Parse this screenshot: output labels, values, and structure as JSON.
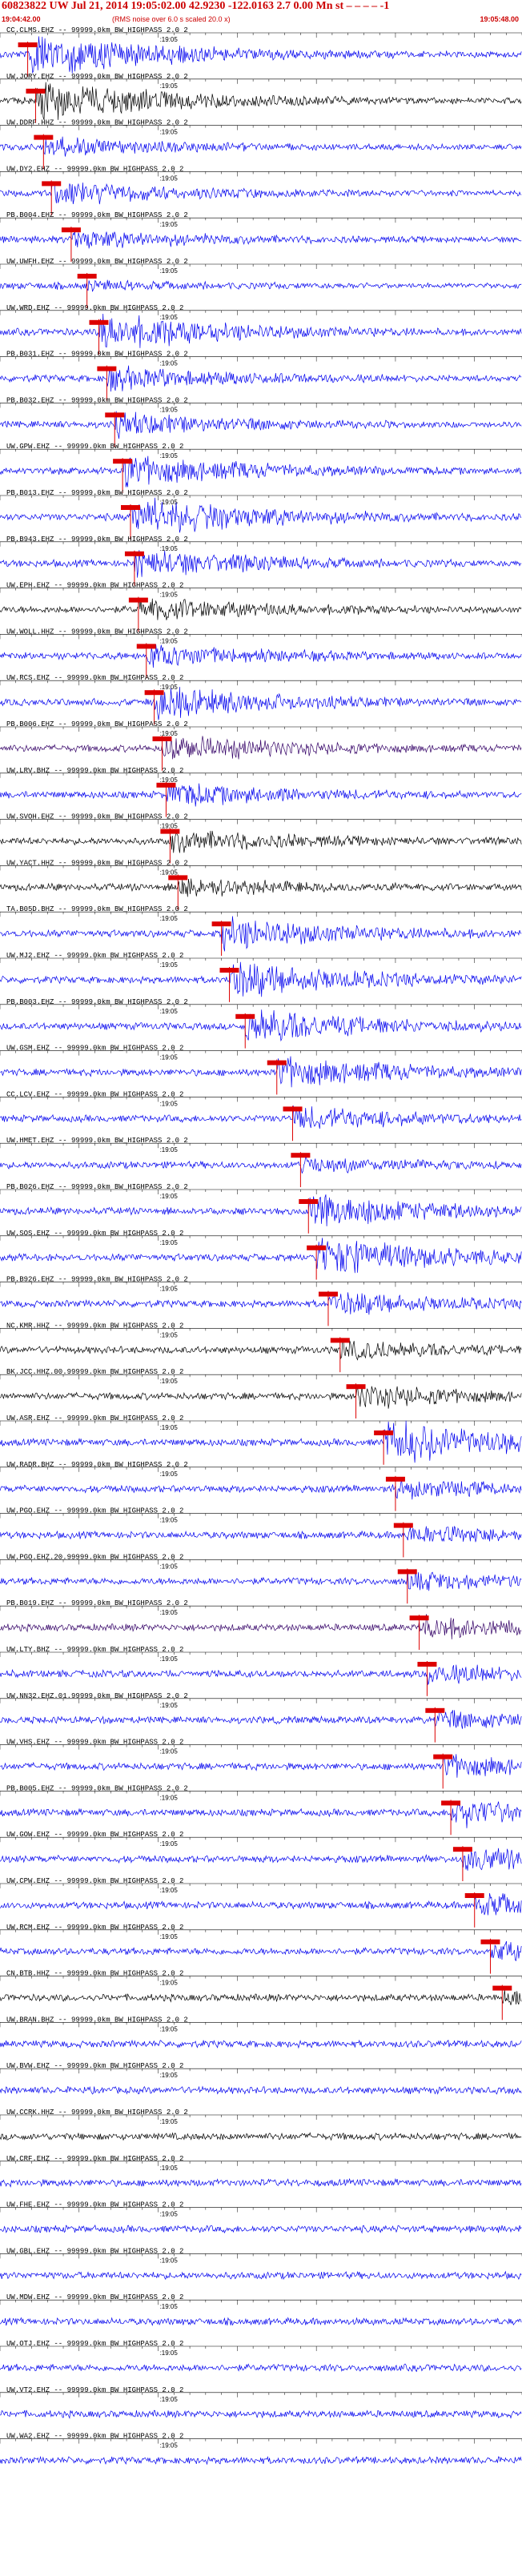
{
  "header": {
    "title": "60823822 UW Jul 21, 2014 19:05:02.00   42.9230  -122.0163   2.7  0.00  Mn st  – – – –  -1",
    "start_time": "19:04:42.00",
    "rms_note": "(RMS noise over 6.0 s scaled 20.0 x)",
    "end_time": "19:05:48.00"
  },
  "colors": {
    "header_red": "#cc0000",
    "pick_red": "#dd0000",
    "blue": "#0000ee",
    "black": "#000000",
    "purple": "#330066"
  },
  "chart_data": {
    "type": "line",
    "title": "60823822 UW Jul 21, 2014 19:05:02.00",
    "x_start": "19:04:42.00",
    "x_end": "19:05:48.00",
    "xlim_seconds": [
      0,
      66
    ],
    "minute_tick_label": ":19:05",
    "grid": false,
    "series": [
      {
        "name": "CC.CLMS.EHZ -- 99999.0km BW_HIGHPASS 2.0 2",
        "color": "#0000ee",
        "pick_s": 3.5,
        "amp": 1.0
      },
      {
        "name": "UW.JORY.EHZ -- 99999.0km BW_HIGHPASS 2.0 2",
        "color": "#000000",
        "pick_s": 4.5,
        "amp": 0.9
      },
      {
        "name": "UW.DDRF.HHZ -- 99999.0km BW_HIGHPASS 2.0 2",
        "color": "#0000ee",
        "pick_s": 5.5,
        "amp": 0.4
      },
      {
        "name": "UW.DY2.EHZ -- 99999.0km BW_HIGHPASS 2.0 2",
        "color": "#0000ee",
        "pick_s": 6.5,
        "amp": 0.5
      },
      {
        "name": "PB.B004.EHZ -- 99999.0km BW_HIGHPASS 2.0 2",
        "color": "#0000ee",
        "pick_s": 9.0,
        "amp": 0.4
      },
      {
        "name": "UW.UWFH.EHZ -- 99999.0km BW_HIGHPASS 2.0 2",
        "color": "#0000ee",
        "pick_s": 11.0,
        "amp": 0.15
      },
      {
        "name": "UW.WRD.EHZ -- 99999.0km BW_HIGHPASS 2.0 2",
        "color": "#0000ee",
        "pick_s": 12.5,
        "amp": 0.8
      },
      {
        "name": "PB.B031.EHZ -- 99999.0km BW_HIGHPASS 2.0 2",
        "color": "#0000ee",
        "pick_s": 13.5,
        "amp": 0.5
      },
      {
        "name": "PB.B032.EHZ -- 99999.0km BW_HIGHPASS 2.0 2",
        "color": "#0000ee",
        "pick_s": 14.5,
        "amp": 0.5
      },
      {
        "name": "UW.GPW.EHZ -- 99999.0km BW_HIGHPASS 2.0 2",
        "color": "#0000ee",
        "pick_s": 15.5,
        "amp": 0.7
      },
      {
        "name": "PB.B013.EHZ -- 99999.0km BW_HIGHPASS 2.0 2",
        "color": "#0000ee",
        "pick_s": 16.5,
        "amp": 0.9
      },
      {
        "name": "PB.B943.EHZ -- 99999.0km BW_HIGHPASS 2.0 2",
        "color": "#0000ee",
        "pick_s": 17.0,
        "amp": 0.6
      },
      {
        "name": "UW.EPH.EHZ -- 99999.0km BW_HIGHPASS 2.0 2",
        "color": "#000000",
        "pick_s": 17.5,
        "amp": 0.5
      },
      {
        "name": "UW.WOLL.HHZ -- 99999.0km BW_HIGHPASS 2.0 2",
        "color": "#0000ee",
        "pick_s": 18.5,
        "amp": 0.5
      },
      {
        "name": "UW.RCS.EHZ -- 99999.0km BW_HIGHPASS 2.0 2",
        "color": "#0000ee",
        "pick_s": 19.5,
        "amp": 0.7
      },
      {
        "name": "PB.B006.EHZ -- 99999.0km BW_HIGHPASS 2.0 2",
        "color": "#330066",
        "pick_s": 20.5,
        "amp": 0.6
      },
      {
        "name": "UW.LRV.BHZ -- 99999.0km BW_HIGHPASS 2.0 2",
        "color": "#0000ee",
        "pick_s": 21.0,
        "amp": 0.5
      },
      {
        "name": "UW.SVOH.EHZ -- 99999.0km BW_HIGHPASS 2.0 2",
        "color": "#000000",
        "pick_s": 21.5,
        "amp": 0.5
      },
      {
        "name": "UW.YACT.HHZ -- 99999.0km BW_HIGHPASS 2.0 2",
        "color": "#000000",
        "pick_s": 22.5,
        "amp": 0.4
      },
      {
        "name": "TA.B05D.BHZ -- 99999.0km BW_HIGHPASS 2.0 2",
        "color": "#0000ee",
        "pick_s": 28.0,
        "amp": 0.7
      },
      {
        "name": "UW.MJ2.EHZ -- 99999.0km BW_HIGHPASS 2.0 2",
        "color": "#0000ee",
        "pick_s": 29.0,
        "amp": 0.8
      },
      {
        "name": "PB.B003.EHZ -- 99999.0km BW_HIGHPASS 2.0 2",
        "color": "#0000ee",
        "pick_s": 31.0,
        "amp": 0.8
      },
      {
        "name": "UW.GSM.EHZ -- 99999.0km BW_HIGHPASS 2.0 2",
        "color": "#0000ee",
        "pick_s": 35.0,
        "amp": 0.7
      },
      {
        "name": "CC.LCV.EHZ -- 99999.0km BW_HIGHPASS 2.0 2",
        "color": "#0000ee",
        "pick_s": 37.0,
        "amp": 0.5
      },
      {
        "name": "UW.HMET.EHZ -- 99999.0km BW_HIGHPASS 2.0 2",
        "color": "#0000ee",
        "pick_s": 38.0,
        "amp": 0.3
      },
      {
        "name": "PB.B026.EHZ -- 99999.0km BW_HIGHPASS 2.0 2",
        "color": "#0000ee",
        "pick_s": 39.0,
        "amp": 0.8
      },
      {
        "name": "UW.SOS.EHZ -- 99999.0km BW_HIGHPASS 2.0 2",
        "color": "#0000ee",
        "pick_s": 40.0,
        "amp": 0.9
      },
      {
        "name": "PB.B926.EHZ -- 99999.0km BW_HIGHPASS 2.0 2",
        "color": "#0000ee",
        "pick_s": 41.5,
        "amp": 0.5
      },
      {
        "name": "NC.KMR.HHZ -- 99999.0km BW_HIGHPASS 2.0 2",
        "color": "#000000",
        "pick_s": 43.0,
        "amp": 0.4
      },
      {
        "name": "BK.JCC.HHZ.00.99999.0km BW_HIGHPASS 2.0 2",
        "color": "#000000",
        "pick_s": 45.0,
        "amp": 0.5
      },
      {
        "name": "UW.ASR.EHZ -- 99999.0km BW_HIGHPASS 2.0 2",
        "color": "#0000ee",
        "pick_s": 48.5,
        "amp": 1.0
      },
      {
        "name": "UW.RADR.BHZ -- 99999.0km BW_HIGHPASS 2.0 2",
        "color": "#0000ee",
        "pick_s": 50.0,
        "amp": 0.4
      },
      {
        "name": "UW.PGO.EHZ -- 99999.0km BW_HIGHPASS 2.0 2",
        "color": "#0000ee",
        "pick_s": 51.0,
        "amp": 0.4
      },
      {
        "name": "UW.PGO.EHZ.20.99999.0km BW_HIGHPASS 2.0 2",
        "color": "#0000ee",
        "pick_s": 51.5,
        "amp": 0.4
      },
      {
        "name": "PB.B019.EHZ -- 99999.0km BW_HIGHPASS 2.0 2",
        "color": "#330066",
        "pick_s": 53.0,
        "amp": 0.5
      },
      {
        "name": "UW.LTY.BHZ -- 99999.0km BW_HIGHPASS 2.0 2",
        "color": "#0000ee",
        "pick_s": 54.0,
        "amp": 0.4
      },
      {
        "name": "UW.NN32.EHZ.01.99999.0km BW_HIGHPASS 2.0 2",
        "color": "#0000ee",
        "pick_s": 55.0,
        "amp": 0.4
      },
      {
        "name": "UW.VHS.EHZ -- 99999.0km BW_HIGHPASS 2.0 2",
        "color": "#0000ee",
        "pick_s": 56.0,
        "amp": 0.5
      },
      {
        "name": "PB.B005.EHZ -- 99999.0km BW_HIGHPASS 2.0 2",
        "color": "#0000ee",
        "pick_s": 57.0,
        "amp": 0.6
      },
      {
        "name": "UW.GOW.EHZ -- 99999.0km BW_HIGHPASS 2.0 2",
        "color": "#0000ee",
        "pick_s": 58.5,
        "amp": 0.5
      },
      {
        "name": "UW.CPW.EHZ -- 99999.0km BW_HIGHPASS 2.0 2",
        "color": "#0000ee",
        "pick_s": 60.0,
        "amp": 0.5
      },
      {
        "name": "UW.RCM.EHZ -- 99999.0km BW_HIGHPASS 2.0 2",
        "color": "#0000ee",
        "pick_s": 62.0,
        "amp": 0.4
      },
      {
        "name": "CN.BTB.HHZ -- 99999.0km BW_HIGHPASS 2.0 2",
        "color": "#000000",
        "pick_s": 63.5,
        "amp": 0.3
      },
      {
        "name": "UW.BRAN.BHZ -- 99999.0km BW_HIGHPASS 2.0 2",
        "color": "#0000ee",
        "pick_s": null,
        "amp": 0.3
      },
      {
        "name": "UW.BVW.EHZ -- 99999.0km BW_HIGHPASS 2.0 2",
        "color": "#0000ee",
        "pick_s": null,
        "amp": 0.3
      },
      {
        "name": "UW.CCRK.HHZ -- 99999.0km BW_HIGHPASS 2.0 2",
        "color": "#000000",
        "pick_s": null,
        "amp": 0.3
      },
      {
        "name": "UW.CRF.EHZ -- 99999.0km BW_HIGHPASS 2.0 2",
        "color": "#0000ee",
        "pick_s": null,
        "amp": 0.3
      },
      {
        "name": "UW.FHE.EHZ -- 99999.0km BW_HIGHPASS 2.0 2",
        "color": "#0000ee",
        "pick_s": null,
        "amp": 0.3
      },
      {
        "name": "UW.GBL.EHZ -- 99999.0km BW_HIGHPASS 2.0 2",
        "color": "#0000ee",
        "pick_s": null,
        "amp": 0.3
      },
      {
        "name": "UW.MDW.EHZ -- 99999.0km BW_HIGHPASS 2.0 2",
        "color": "#0000ee",
        "pick_s": null,
        "amp": 0.3
      },
      {
        "name": "UW.OTJ.EHZ -- 99999.0km BW_HIGHPASS 2.0 2",
        "color": "#0000ee",
        "pick_s": null,
        "amp": 0.3
      },
      {
        "name": "UW.VT2.EHZ -- 99999.0km BW_HIGHPASS 2.0 2",
        "color": "#0000ee",
        "pick_s": null,
        "amp": 0.3
      },
      {
        "name": "UW.WA2.EHZ -- 99999.0km BW_HIGHPASS 2.0 2",
        "color": "#0000ee",
        "pick_s": null,
        "amp": 0.3
      }
    ]
  }
}
